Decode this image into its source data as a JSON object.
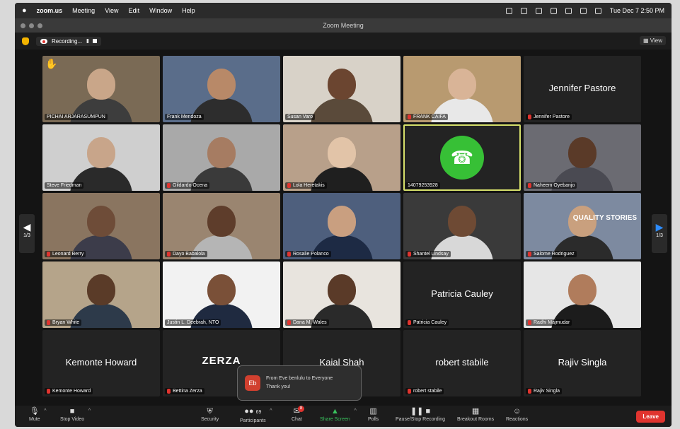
{
  "menubar": {
    "apple": "",
    "app": "zoom.us",
    "menus": [
      "Meeting",
      "View",
      "Edit",
      "Window",
      "Help"
    ],
    "clock": "Tue Dec 7  2:50 PM"
  },
  "window": {
    "title": "Zoom Meeting"
  },
  "topbar": {
    "recording_label": "Recording...",
    "pause_glyph": "II",
    "view_label": "View"
  },
  "page_indicator": {
    "left": "1/3",
    "right": "1/3"
  },
  "participants": [
    {
      "name": "PICHAI ARJARASUMPUN",
      "muted": false,
      "kind": "video",
      "bg": "#7a6a55",
      "skin": "#c9a689",
      "shirt": "#3d3d3d",
      "hand": true
    },
    {
      "name": "Frank Mendoza",
      "muted": false,
      "kind": "video",
      "bg": "#5a6d8a",
      "skin": "#b88968",
      "shirt": "#2d2d2d"
    },
    {
      "name": "Susan Varo",
      "muted": false,
      "kind": "video",
      "bg": "#d8d2c8",
      "skin": "#6b4530",
      "shirt": "#5a4a3a"
    },
    {
      "name": "FRANK CAIFA",
      "muted": true,
      "kind": "video",
      "bg": "#b89a70",
      "skin": "#d9b497",
      "shirt": "#e8e8e8"
    },
    {
      "name": "Jennifer Pastore",
      "muted": true,
      "kind": "name",
      "big": "Jennifer Pastore"
    },
    {
      "name": "Steve Friedman",
      "muted": false,
      "kind": "video",
      "bg": "#cfcfcf",
      "skin": "#c8a58a",
      "shirt": "#2a2a2a"
    },
    {
      "name": "Gildardo Ocena",
      "muted": true,
      "kind": "video",
      "bg": "#a9a9a9",
      "skin": "#a67c62",
      "shirt": "#3a3a3a"
    },
    {
      "name": "Lola Heretakis",
      "muted": true,
      "kind": "video",
      "bg": "#b8a08a",
      "skin": "#e2c4a8",
      "shirt": "#1f1f1f"
    },
    {
      "name": "14079253928",
      "muted": false,
      "kind": "phone",
      "active": true
    },
    {
      "name": "Naheem Oyebanjo",
      "muted": true,
      "kind": "video",
      "bg": "#6b6b72",
      "skin": "#5a3a28",
      "shirt": "#4a4a52"
    },
    {
      "name": "Leonard Berry",
      "muted": true,
      "kind": "video",
      "bg": "#8a7560",
      "skin": "#6e4c38",
      "shirt": "#3c3c4a"
    },
    {
      "name": "Dayo Babalola",
      "muted": true,
      "kind": "video",
      "bg": "#9a8570",
      "skin": "#5e3d2b",
      "shirt": "#b5b5b5"
    },
    {
      "name": "Rosalie Polanco",
      "muted": true,
      "kind": "video",
      "bg": "#4e5f7d",
      "skin": "#c99f80",
      "shirt": "#1d2a44"
    },
    {
      "name": "Shantel Lindsay",
      "muted": true,
      "kind": "video",
      "bg": "#3a3a3a",
      "skin": "#6e4a34",
      "shirt": "#d8d8d8"
    },
    {
      "name": "Salome Rodriguez",
      "muted": true,
      "kind": "video",
      "bg": "#7d8aa0",
      "skin": "#c9a07e",
      "shirt": "#2b2b2b",
      "overlay": "QUALITY STORIES"
    },
    {
      "name": "Bryan White",
      "muted": true,
      "kind": "video",
      "bg": "#b5a48a",
      "skin": "#5a3b28",
      "shirt": "#2d3a4a"
    },
    {
      "name": "Justin L. Deebrah, NTO",
      "muted": false,
      "kind": "video",
      "bg": "#f2f2f2",
      "skin": "#7a5038",
      "shirt": "#1f2a40"
    },
    {
      "name": "Dana M. Wales",
      "muted": true,
      "kind": "video",
      "bg": "#e8e4de",
      "skin": "#5a3a28",
      "shirt": "#2a2a2a"
    },
    {
      "name": "Patricia Cauley",
      "muted": true,
      "kind": "name",
      "big": "Patricia Cauley"
    },
    {
      "name": "Radhi Majmudar",
      "muted": true,
      "kind": "video",
      "bg": "#e6e6e6",
      "skin": "#b07c5c",
      "shirt": "#1c1c1c"
    },
    {
      "name": "Kemonte Howard",
      "muted": true,
      "kind": "name",
      "big": "Kemonte Howard"
    },
    {
      "name": "Bettina Zerza",
      "muted": true,
      "kind": "name",
      "big": "ZERZA",
      "logo": true
    },
    {
      "name": "",
      "muted": false,
      "kind": "name",
      "big": "Kajal Shah",
      "partial": true
    },
    {
      "name": "robert stabile",
      "muted": true,
      "kind": "name",
      "big": "robert stabile"
    },
    {
      "name": "Rajiv Singla",
      "muted": true,
      "kind": "name",
      "big": "Rajiv Singla"
    }
  ],
  "chat_toast": {
    "avatar": "Eb",
    "from": "From Eve benlulu to Everyone",
    "message": "Thank you!"
  },
  "toolbar": {
    "mute": "Mute",
    "stop_video": "Stop Video",
    "security": "Security",
    "participants": "Participants",
    "participants_count": "69",
    "chat": "Chat",
    "chat_badge": "8",
    "share_screen": "Share Screen",
    "polls": "Polls",
    "recording": "Pause/Stop Recording",
    "breakout": "Breakout Rooms",
    "reactions": "Reactions",
    "leave": "Leave"
  },
  "colors": {
    "share_green": "#39c15d",
    "leave_red": "#e0342f",
    "active_border": "#d6e06b"
  }
}
